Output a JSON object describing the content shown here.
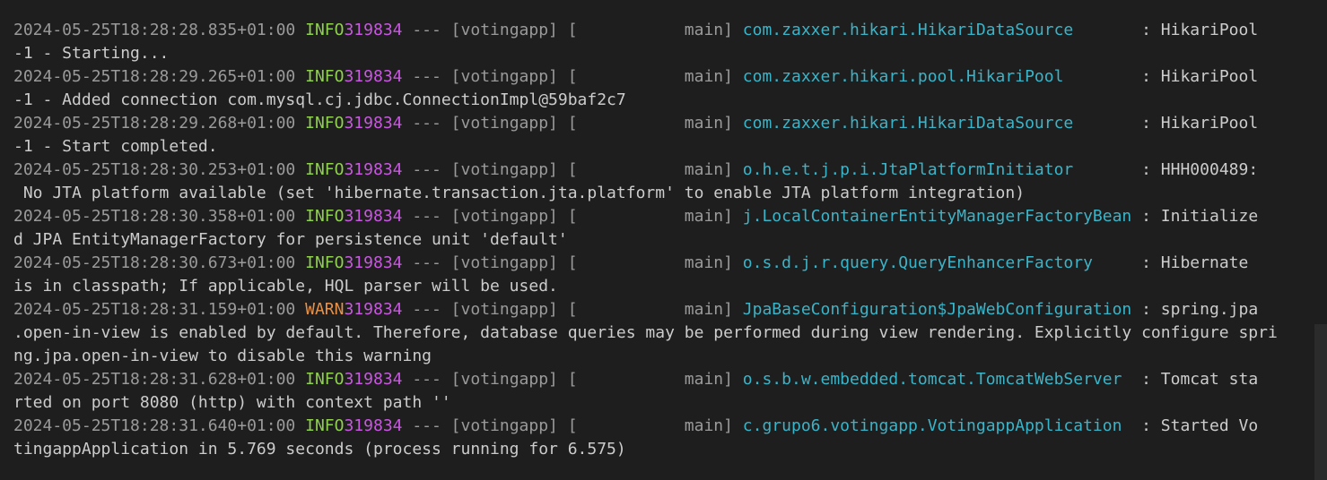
{
  "colors": {
    "background": "#1e1e1e",
    "timestamp": "#9a9a9a",
    "info": "#8fd14f",
    "warn": "#e69147",
    "pid": "#c858e0",
    "logger": "#3ab4c8",
    "text": "#cccccc"
  },
  "lines": [
    {
      "ts": "2024-05-25T18:28:28.835+01:00",
      "lvl": " INFO",
      "pid": "319834",
      "mid": " --- [votingapp] [           main] ",
      "logger": "com.zaxxer.hikari.HikariDataSource      ",
      "msg": " : HikariPool"
    },
    {
      "text": "-1 - Starting..."
    },
    {
      "ts": "2024-05-25T18:28:29.265+01:00",
      "lvl": " INFO",
      "pid": "319834",
      "mid": " --- [votingapp] [           main] ",
      "logger": "com.zaxxer.hikari.pool.HikariPool       ",
      "msg": " : HikariPool"
    },
    {
      "text": "-1 - Added connection com.mysql.cj.jdbc.ConnectionImpl@59baf2c7"
    },
    {
      "ts": "2024-05-25T18:28:29.268+01:00",
      "lvl": " INFO",
      "pid": "319834",
      "mid": " --- [votingapp] [           main] ",
      "logger": "com.zaxxer.hikari.HikariDataSource      ",
      "msg": " : HikariPool"
    },
    {
      "text": "-1 - Start completed."
    },
    {
      "ts": "2024-05-25T18:28:30.253+01:00",
      "lvl": " INFO",
      "pid": "319834",
      "mid": " --- [votingapp] [           main] ",
      "logger": "o.h.e.t.j.p.i.JtaPlatformInitiator      ",
      "msg": " : HHH000489:"
    },
    {
      "text": " No JTA platform available (set 'hibernate.transaction.jta.platform' to enable JTA platform integration)"
    },
    {
      "ts": "2024-05-25T18:28:30.358+01:00",
      "lvl": " INFO",
      "pid": "319834",
      "mid": " --- [votingapp] [           main] ",
      "logger": "j.LocalContainerEntityManagerFactoryBean",
      "msg": " : Initialize"
    },
    {
      "text": "d JPA EntityManagerFactory for persistence unit 'default'"
    },
    {
      "ts": "2024-05-25T18:28:30.673+01:00",
      "lvl": " INFO",
      "pid": "319834",
      "mid": " --- [votingapp] [           main] ",
      "logger": "o.s.d.j.r.query.QueryEnhancerFactory    ",
      "msg": " : Hibernate "
    },
    {
      "text": "is in classpath; If applicable, HQL parser will be used."
    },
    {
      "ts": "2024-05-25T18:28:31.159+01:00",
      "lvl": " WARN",
      "pid": "319834",
      "mid": " --- [votingapp] [           main] ",
      "logger": "JpaBaseConfiguration$JpaWebConfiguration",
      "msg": " : spring.jpa"
    },
    {
      "text": ".open-in-view is enabled by default. Therefore, database queries may be performed during view rendering. Explicitly configure spri"
    },
    {
      "text": "ng.jpa.open-in-view to disable this warning"
    },
    {
      "ts": "2024-05-25T18:28:31.628+01:00",
      "lvl": " INFO",
      "pid": "319834",
      "mid": " --- [votingapp] [           main] ",
      "logger": "o.s.b.w.embedded.tomcat.TomcatWebServer ",
      "msg": " : Tomcat sta"
    },
    {
      "text": "rted on port 8080 (http) with context path ''"
    },
    {
      "ts": "2024-05-25T18:28:31.640+01:00",
      "lvl": " INFO",
      "pid": "319834",
      "mid": " --- [votingapp] [           main] ",
      "logger": "c.grupo6.votingapp.VotingappApplication ",
      "msg": " : Started Vo"
    },
    {
      "text": "tingappApplication in 5.769 seconds (process running for 6.575)"
    }
  ]
}
